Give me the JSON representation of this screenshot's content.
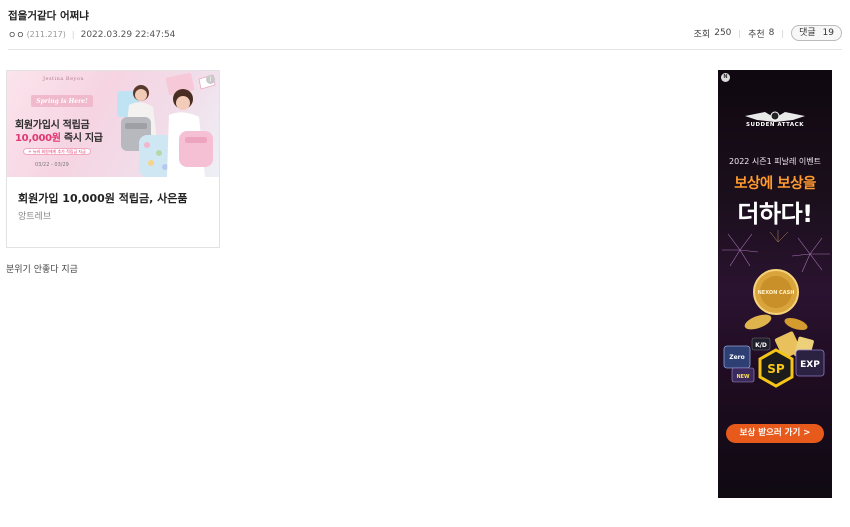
{
  "post": {
    "title": "접을거같다 어쩌냐",
    "author": "ㅇㅇ",
    "ip": "(211.217)",
    "date": "2022.03.29 22:47:54",
    "views_label": "조회",
    "views": "250",
    "recommend_label": "추천",
    "recommend": "8",
    "reply_label": "댓글",
    "reply_count": "19",
    "content": "분위기 안좋다 지금"
  },
  "ad_card": {
    "brand": "Jestina Beyou",
    "banner_text": "Spring is Here!",
    "image_line1": "회원가입시 적립금",
    "image_line2_amount": "10,000원",
    "image_line2_rest": " 즉시 지급",
    "image_pill": "+ 뉴비 회원에게 추가 적립금 지급",
    "image_date": "03/22 - 03/29",
    "title": "회원가입 10,000원 적립금, 사은품",
    "source": "앙트레브",
    "info_icon": "info-icon"
  },
  "side_ad": {
    "badge": "N",
    "logo_text": "SUDDEN ATTACK",
    "event": "2022 시즌1 피날레 이벤트",
    "headline1": "보상에 보상을",
    "headline2": "더하다!",
    "medal_text": "NEXON CASH",
    "chip_zero": "Zero",
    "chip_new": "NEW",
    "chip_sp": "SP",
    "chip_exp": "EXP",
    "chip_kd": "K/D",
    "cta": "보상 받으러 가기 >"
  },
  "colors": {
    "accent_pink": "#e0386f",
    "cta_orange": "#e75a1b",
    "headline_orange": "#ff9a2e"
  }
}
